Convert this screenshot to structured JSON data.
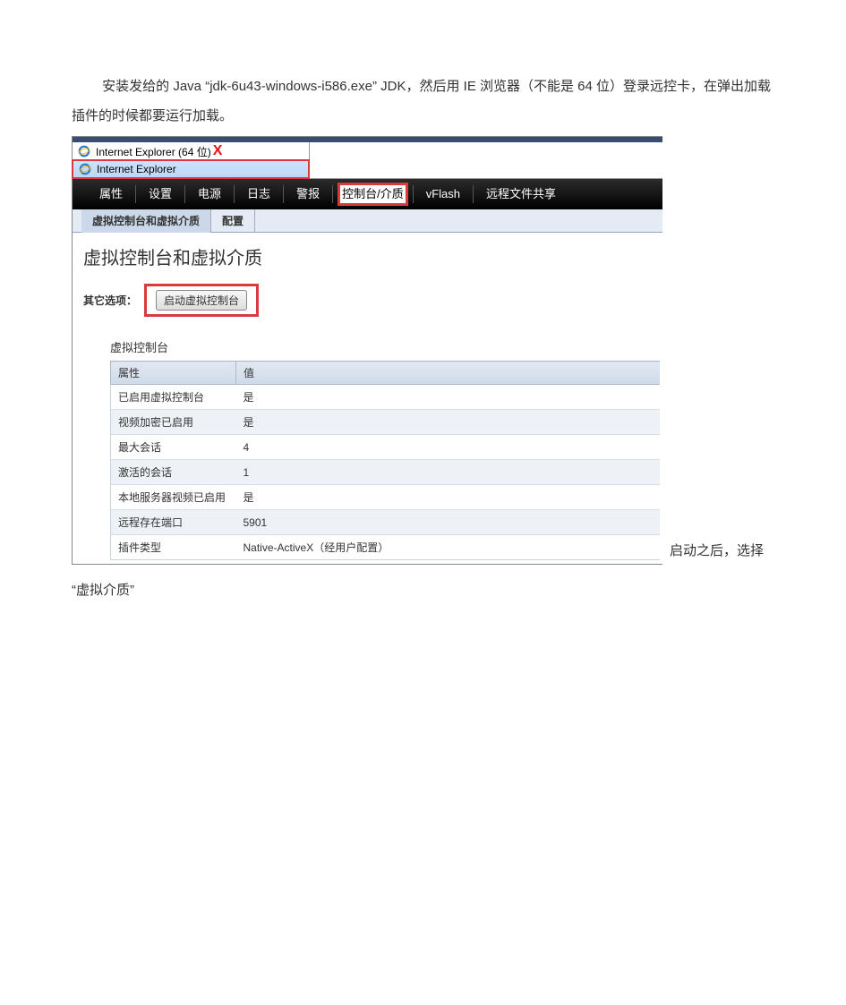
{
  "document": {
    "para1_part1": "安装发给的 Java",
    "para1_quote": "“jdk-6u43-windows-i586.exe”",
    "para1_part2": "JDK，然后用 IE 浏览器（不能是 64 位）登录远控卡，在弹出加载插件的时候都要运行加载。",
    "trailing_text": "启动之后，选择",
    "continue_text": "“虚拟介质”"
  },
  "startmenu": {
    "ie64_label": "Internet Explorer (64 位)",
    "ie_label": "Internet Explorer",
    "x_mark": "X"
  },
  "topnav": {
    "items": [
      "属性",
      "设置",
      "电源",
      "日志",
      "警报",
      "控制台/介质",
      "vFlash",
      "远程文件共享"
    ]
  },
  "subtabs": {
    "tab1": "虚拟控制台和虚拟介质",
    "tab2": "配置"
  },
  "content": {
    "heading": "虚拟控制台和虚拟介质",
    "options_label": "其它选项：",
    "launch_button": "启动虚拟控制台",
    "section_title": "虚拟控制台",
    "table": {
      "col1": "属性",
      "col2": "值",
      "rows": [
        {
          "k": "已启用虚拟控制台",
          "v": "是"
        },
        {
          "k": "视频加密已启用",
          "v": "是"
        },
        {
          "k": "最大会话",
          "v": "4"
        },
        {
          "k": "激活的会话",
          "v": "1"
        },
        {
          "k": "本地服务器视频已启用",
          "v": "是"
        },
        {
          "k": "远程存在端口",
          "v": "5901"
        },
        {
          "k": "插件类型",
          "v": "Native-ActiveX（经用户配置）"
        }
      ]
    }
  }
}
